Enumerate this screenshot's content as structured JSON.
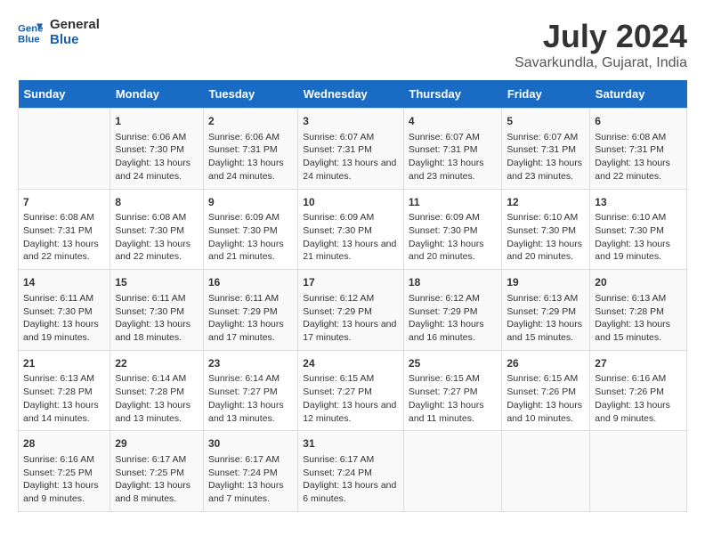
{
  "logo": {
    "line1": "General",
    "line2": "Blue"
  },
  "title": "July 2024",
  "subtitle": "Savarkundla, Gujarat, India",
  "days_of_week": [
    "Sunday",
    "Monday",
    "Tuesday",
    "Wednesday",
    "Thursday",
    "Friday",
    "Saturday"
  ],
  "weeks": [
    [
      {
        "day": "",
        "info": ""
      },
      {
        "day": "1",
        "info": "Sunrise: 6:06 AM\nSunset: 7:30 PM\nDaylight: 13 hours and 24 minutes."
      },
      {
        "day": "2",
        "info": "Sunrise: 6:06 AM\nSunset: 7:31 PM\nDaylight: 13 hours and 24 minutes."
      },
      {
        "day": "3",
        "info": "Sunrise: 6:07 AM\nSunset: 7:31 PM\nDaylight: 13 hours and 24 minutes."
      },
      {
        "day": "4",
        "info": "Sunrise: 6:07 AM\nSunset: 7:31 PM\nDaylight: 13 hours and 23 minutes."
      },
      {
        "day": "5",
        "info": "Sunrise: 6:07 AM\nSunset: 7:31 PM\nDaylight: 13 hours and 23 minutes."
      },
      {
        "day": "6",
        "info": "Sunrise: 6:08 AM\nSunset: 7:31 PM\nDaylight: 13 hours and 22 minutes."
      }
    ],
    [
      {
        "day": "7",
        "info": "Sunrise: 6:08 AM\nSunset: 7:31 PM\nDaylight: 13 hours and 22 minutes."
      },
      {
        "day": "8",
        "info": "Sunrise: 6:08 AM\nSunset: 7:30 PM\nDaylight: 13 hours and 22 minutes."
      },
      {
        "day": "9",
        "info": "Sunrise: 6:09 AM\nSunset: 7:30 PM\nDaylight: 13 hours and 21 minutes."
      },
      {
        "day": "10",
        "info": "Sunrise: 6:09 AM\nSunset: 7:30 PM\nDaylight: 13 hours and 21 minutes."
      },
      {
        "day": "11",
        "info": "Sunrise: 6:09 AM\nSunset: 7:30 PM\nDaylight: 13 hours and 20 minutes."
      },
      {
        "day": "12",
        "info": "Sunrise: 6:10 AM\nSunset: 7:30 PM\nDaylight: 13 hours and 20 minutes."
      },
      {
        "day": "13",
        "info": "Sunrise: 6:10 AM\nSunset: 7:30 PM\nDaylight: 13 hours and 19 minutes."
      }
    ],
    [
      {
        "day": "14",
        "info": "Sunrise: 6:11 AM\nSunset: 7:30 PM\nDaylight: 13 hours and 19 minutes."
      },
      {
        "day": "15",
        "info": "Sunrise: 6:11 AM\nSunset: 7:30 PM\nDaylight: 13 hours and 18 minutes."
      },
      {
        "day": "16",
        "info": "Sunrise: 6:11 AM\nSunset: 7:29 PM\nDaylight: 13 hours and 17 minutes."
      },
      {
        "day": "17",
        "info": "Sunrise: 6:12 AM\nSunset: 7:29 PM\nDaylight: 13 hours and 17 minutes."
      },
      {
        "day": "18",
        "info": "Sunrise: 6:12 AM\nSunset: 7:29 PM\nDaylight: 13 hours and 16 minutes."
      },
      {
        "day": "19",
        "info": "Sunrise: 6:13 AM\nSunset: 7:29 PM\nDaylight: 13 hours and 15 minutes."
      },
      {
        "day": "20",
        "info": "Sunrise: 6:13 AM\nSunset: 7:28 PM\nDaylight: 13 hours and 15 minutes."
      }
    ],
    [
      {
        "day": "21",
        "info": "Sunrise: 6:13 AM\nSunset: 7:28 PM\nDaylight: 13 hours and 14 minutes."
      },
      {
        "day": "22",
        "info": "Sunrise: 6:14 AM\nSunset: 7:28 PM\nDaylight: 13 hours and 13 minutes."
      },
      {
        "day": "23",
        "info": "Sunrise: 6:14 AM\nSunset: 7:27 PM\nDaylight: 13 hours and 13 minutes."
      },
      {
        "day": "24",
        "info": "Sunrise: 6:15 AM\nSunset: 7:27 PM\nDaylight: 13 hours and 12 minutes."
      },
      {
        "day": "25",
        "info": "Sunrise: 6:15 AM\nSunset: 7:27 PM\nDaylight: 13 hours and 11 minutes."
      },
      {
        "day": "26",
        "info": "Sunrise: 6:15 AM\nSunset: 7:26 PM\nDaylight: 13 hours and 10 minutes."
      },
      {
        "day": "27",
        "info": "Sunrise: 6:16 AM\nSunset: 7:26 PM\nDaylight: 13 hours and 9 minutes."
      }
    ],
    [
      {
        "day": "28",
        "info": "Sunrise: 6:16 AM\nSunset: 7:25 PM\nDaylight: 13 hours and 9 minutes."
      },
      {
        "day": "29",
        "info": "Sunrise: 6:17 AM\nSunset: 7:25 PM\nDaylight: 13 hours and 8 minutes."
      },
      {
        "day": "30",
        "info": "Sunrise: 6:17 AM\nSunset: 7:24 PM\nDaylight: 13 hours and 7 minutes."
      },
      {
        "day": "31",
        "info": "Sunrise: 6:17 AM\nSunset: 7:24 PM\nDaylight: 13 hours and 6 minutes."
      },
      {
        "day": "",
        "info": ""
      },
      {
        "day": "",
        "info": ""
      },
      {
        "day": "",
        "info": ""
      }
    ]
  ]
}
